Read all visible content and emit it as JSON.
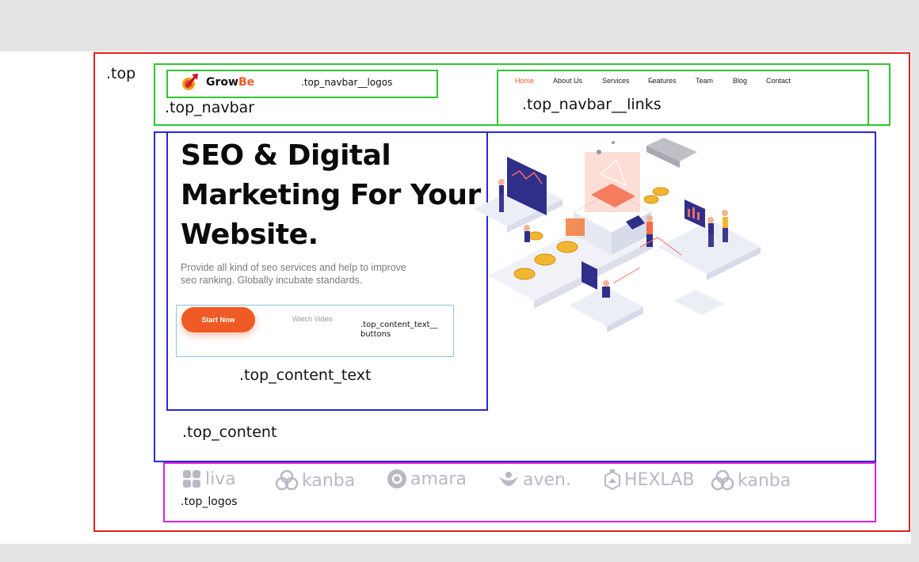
{
  "annotations": {
    "top": ".top",
    "top_navbar": ".top_navbar",
    "top_navbar_logos": ".top_navbar__logos",
    "top_navbar_links": ".top_navbar__links",
    "top_content": ".top_content",
    "top_content_text": ".top_content_text",
    "top_content_text_buttons_line1": ".top_content_text__",
    "top_content_text_buttons_line2": "buttons",
    "top_logos": ".top_logos"
  },
  "brand": {
    "part1": "Grow",
    "part2": "Be",
    "accent": "#f05a24"
  },
  "nav": {
    "items": [
      "Home",
      "About Us",
      "Services",
      "Features",
      "Team",
      "Blog",
      "Contact"
    ],
    "active": "Home",
    "features_caret": "⌄"
  },
  "hero": {
    "title_lines": [
      "SEO & Digital",
      "Marketing For Your",
      "Website."
    ],
    "subtitle_lines": [
      "Provide all kind of seo services and help to improve",
      "seo ranking. Globally incubate standards."
    ],
    "start_label": "Start Now",
    "watch_label": "Watch Video"
  },
  "partners": [
    "liva",
    "kanba",
    "amara",
    "aven.",
    "HEXLAB",
    "kanba"
  ],
  "colors": {
    "top_border": "#e02020",
    "navbar_border": "#2ec82e",
    "content_border": "#2a2ad0",
    "buttons_border": "#8fc7d8",
    "logos_border": "#e020e0",
    "accent": "#f05a24"
  }
}
